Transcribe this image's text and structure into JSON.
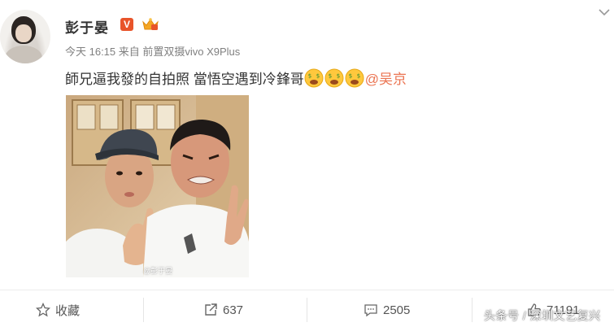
{
  "post": {
    "username": "彭于晏",
    "verified_badge": "V",
    "meta": "今天 16:15 来自 前置双摄vivo X9Plus",
    "text": "師兄逼我發的自拍照 當悟空遇到冷鋒哥",
    "emoji_icon": "money-eyes-face-emoji",
    "emoji_count": 3,
    "mention": "@吴京",
    "photo_watermark": "@彭于晏"
  },
  "actions": {
    "favorite_label": "收藏",
    "repost_count": "637",
    "comment_count": "2505",
    "like_count": "71191"
  },
  "watermark": "头条号 / 深圳文艺复兴",
  "colors": {
    "link": "#eb7350",
    "badge": "#e8542a",
    "meta": "#808080",
    "text": "#333333"
  }
}
